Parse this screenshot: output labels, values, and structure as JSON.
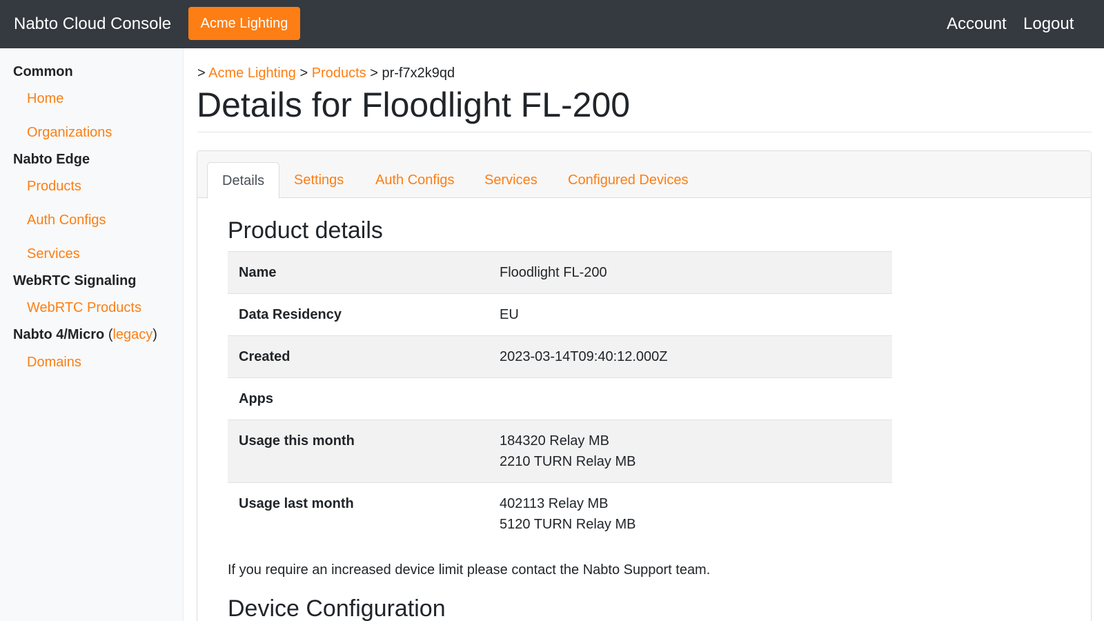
{
  "navbar": {
    "brand": "Nabto Cloud Console",
    "org_button": "Acme Lighting",
    "account": "Account",
    "logout": "Logout"
  },
  "sidebar": {
    "sections": [
      {
        "heading": "Common",
        "items": [
          "Home",
          "Organizations"
        ]
      },
      {
        "heading": "Nabto Edge",
        "items": [
          "Products",
          "Auth Configs",
          "Services"
        ]
      },
      {
        "heading": "WebRTC Signaling",
        "items": [
          "WebRTC Products"
        ]
      },
      {
        "heading": "Nabto 4/Micro",
        "heading_paren_open": "(",
        "heading_link": "legacy",
        "heading_paren_close": ")",
        "items": [
          "Domains"
        ]
      }
    ]
  },
  "breadcrumb": {
    "sep": ">",
    "org": "Acme Lighting",
    "products": "Products",
    "current": "pr-f7x2k9qd"
  },
  "page": {
    "title": "Details for Floodlight FL-200"
  },
  "tabs": [
    "Details",
    "Settings",
    "Auth Configs",
    "Services",
    "Configured Devices"
  ],
  "details": {
    "title": "Product details",
    "rows": [
      {
        "label": "Name",
        "values": [
          "Floodlight FL-200"
        ]
      },
      {
        "label": "Data Residency",
        "values": [
          "EU"
        ]
      },
      {
        "label": "Created",
        "values": [
          "2023-03-14T09:40:12.000Z"
        ]
      },
      {
        "label": "Apps",
        "values": []
      },
      {
        "label": "Usage this month",
        "values": [
          "184320 Relay MB",
          "2210 TURN Relay MB"
        ]
      },
      {
        "label": "Usage last month",
        "values": [
          "402113 Relay MB",
          "5120 TURN Relay MB"
        ]
      }
    ],
    "notice": "If you require an increased device limit please contact the Nabto Support team."
  },
  "device_config": {
    "title": "Device Configuration"
  },
  "colors": {
    "accent": "#fd7e14",
    "navbar_bg": "#343a40",
    "sidebar_bg": "#f8f9fa",
    "stripe_bg": "#f2f2f2"
  }
}
